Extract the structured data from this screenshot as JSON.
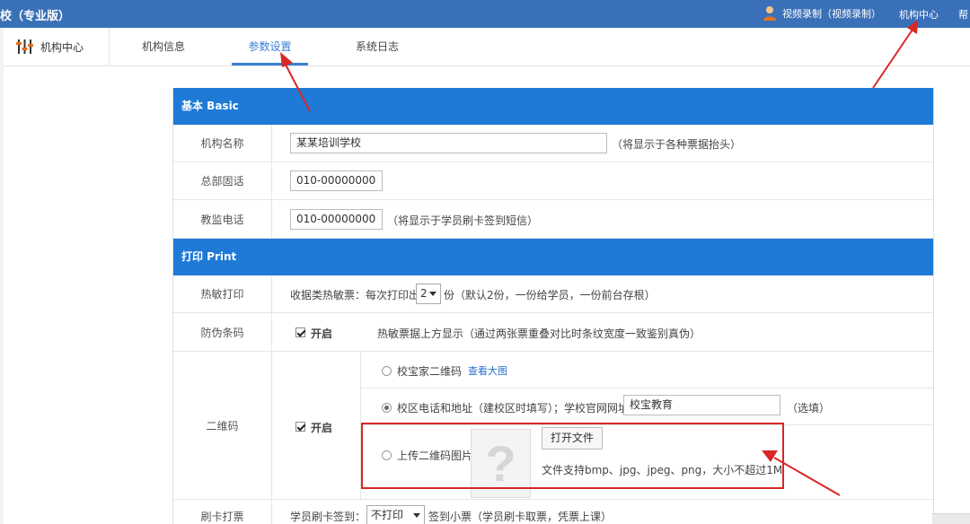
{
  "header": {
    "title": "校（专业版）",
    "user_label": "视频录制（视频录制）",
    "org_center_link": "机构中心",
    "help_link": "帮"
  },
  "tabs": {
    "home": "机构中心",
    "items": [
      {
        "label": "机构信息",
        "active": false
      },
      {
        "label": "参数设置",
        "active": true
      },
      {
        "label": "系统日志",
        "active": false
      }
    ]
  },
  "basic": {
    "heading": "基本 Basic",
    "org_name": {
      "label": "机构名称",
      "value": "某某培训学校",
      "hint": "（将显示于各种票据抬头）"
    },
    "hq_phone": {
      "label": "总部固话",
      "value": "010-00000000"
    },
    "supervisor_phone": {
      "label": "教监电话",
      "value": "010-00000000",
      "hint": "（将显示于学员刷卡签到短信）"
    }
  },
  "print": {
    "heading": "打印 Print",
    "thermal": {
      "label": "热敏打印",
      "prefix": "收据类热敏票：每次打印出",
      "copies": "2",
      "suffix": "份（默认2份，一份给学员，一份前台存根）"
    },
    "barcode": {
      "label": "防伪条码",
      "check_label": "开启",
      "desc": "热敏票据上方显示（通过两张票重叠对比时条纹宽度一致鉴别真伪）"
    },
    "qrcode": {
      "label": "二维码",
      "check_label": "开启",
      "opt1": "校宝家二维码",
      "opt1_link": "查看大图",
      "opt2": "校区电话和地址（建校区时填写）；学校官网网址",
      "opt2_value": "校宝教育",
      "opt2_hint": "（选填）",
      "opt3": "上传二维码图片",
      "open_file": "打开文件",
      "file_hint": "文件支持bmp、jpg、jpeg、png，大小不超过1M",
      "placeholder_glyph": "?"
    },
    "card_print": {
      "label": "刷卡打票",
      "prefix": "学员刷卡签到：",
      "select": "不打印",
      "suffix": "签到小票（学员刷卡取票，凭票上课）"
    }
  },
  "colors": {
    "header_bg": "#3a70b8",
    "section_bg": "#1e7ad6",
    "accent": "#3a7fd5",
    "annotation_red": "#d92626"
  }
}
